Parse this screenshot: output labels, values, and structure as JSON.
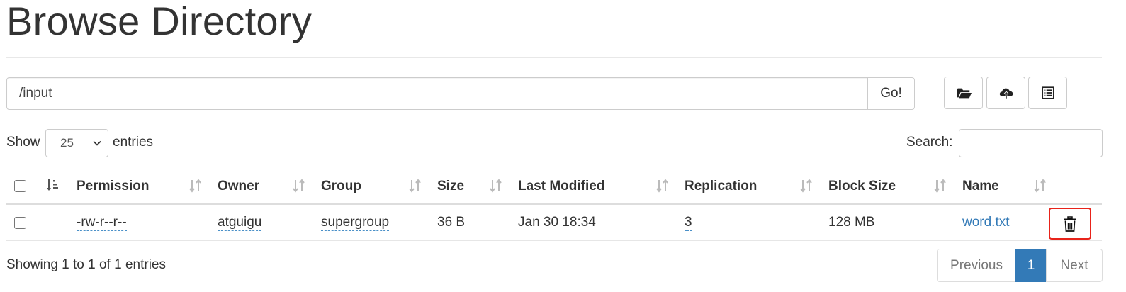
{
  "page": {
    "title": "Browse Directory"
  },
  "path_bar": {
    "value": "/input",
    "go_label": "Go!"
  },
  "toolbar": {
    "icons": [
      "folder-open-icon",
      "cloud-upload-icon",
      "list-alt-icon"
    ]
  },
  "length_control": {
    "show_label": "Show",
    "selected": "25",
    "entries_label": "entries"
  },
  "search": {
    "label": "Search:",
    "value": ""
  },
  "table": {
    "headers": [
      "Permission",
      "Owner",
      "Group",
      "Size",
      "Last Modified",
      "Replication",
      "Block Size",
      "Name"
    ],
    "rows": [
      {
        "permission": "-rw-r--r--",
        "owner": "atguigu",
        "group": "supergroup",
        "size": "36 B",
        "last_modified": "Jan 30 18:34",
        "replication": "3",
        "block_size": "128 MB",
        "name": "word.txt",
        "action_icon": "trash-icon"
      }
    ]
  },
  "info": {
    "text": "Showing 1 to 1 of 1 entries"
  },
  "pagination": {
    "previous": "Previous",
    "current": "1",
    "next": "Next"
  },
  "colors": {
    "link": "#337ab7",
    "highlight": "#e8231a",
    "active_page": "#337ab7"
  }
}
